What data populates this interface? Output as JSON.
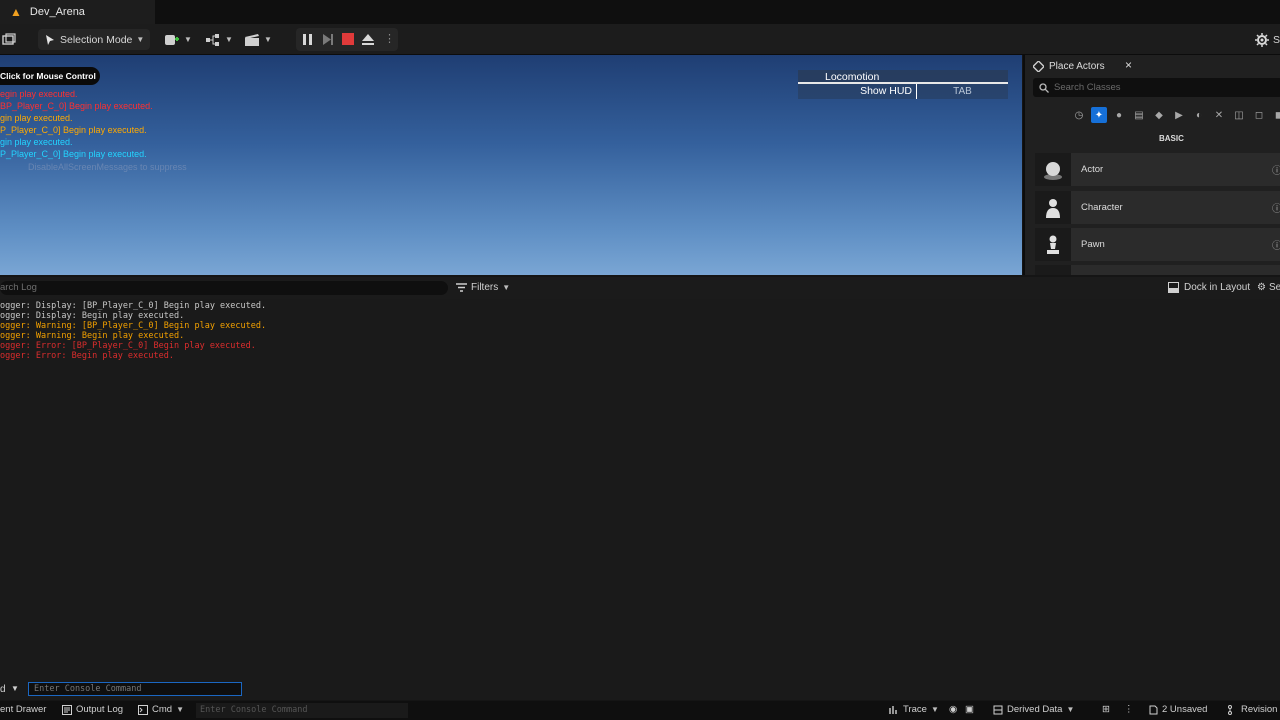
{
  "window": {
    "tab_title": "Dev_Arena"
  },
  "toolbar": {
    "selection_mode": "Selection Mode",
    "settings_label": "S"
  },
  "viewport": {
    "mouse_control": "Click for Mouse Control",
    "messages": [
      {
        "text": "egin play executed.",
        "color": "red"
      },
      {
        "text": "BP_Player_C_0] Begin play executed.",
        "color": "red"
      },
      {
        "text": "gin play executed.",
        "color": "orange"
      },
      {
        "text": "P_Player_C_0] Begin play executed.",
        "color": "orange"
      },
      {
        "text": "gin play executed.",
        "color": "cyan"
      },
      {
        "text": "P_Player_C_0] Begin play executed.",
        "color": "cyan"
      },
      {
        "text": "DisableAllScreenMessages to suppress",
        "color": "hint"
      }
    ],
    "hud": {
      "title": "Locomotion",
      "show_hud": "Show HUD",
      "key": "TAB"
    }
  },
  "place_actors": {
    "tab_label": "Place Actors",
    "close": "×",
    "search_placeholder": "Search Classes",
    "section": "BASIC",
    "actors": [
      {
        "name": "Actor"
      },
      {
        "name": "Character"
      },
      {
        "name": "Pawn"
      }
    ]
  },
  "output_log": {
    "search_placeholder": "arch Log",
    "filters": "Filters",
    "dock": "Dock in Layout",
    "settings": "Se",
    "lines": [
      {
        "text": "ogger: Display: [BP_Player_C_0] Begin play executed.",
        "level": "gray"
      },
      {
        "text": "ogger: Display: Begin play executed.",
        "level": "gray"
      },
      {
        "text": "ogger: Warning: [BP_Player_C_0] Begin play executed.",
        "level": "orange"
      },
      {
        "text": "ogger: Warning: Begin play executed.",
        "level": "orange"
      },
      {
        "text": "ogger: Error: [BP_Player_C_0] Begin play executed.",
        "level": "red"
      },
      {
        "text": "ogger: Error: Begin play executed.",
        "level": "red"
      }
    ]
  },
  "console": {
    "prefix": "d",
    "placeholder": "Enter Console Command"
  },
  "statusbar": {
    "content_drawer": "ent Drawer",
    "output_log": "Output Log",
    "cmd": "Cmd",
    "console_placeholder": "Enter Console Command",
    "trace": "Trace",
    "derived_data": "Derived Data",
    "unsaved": "2 Unsaved",
    "revision": "Revision"
  }
}
